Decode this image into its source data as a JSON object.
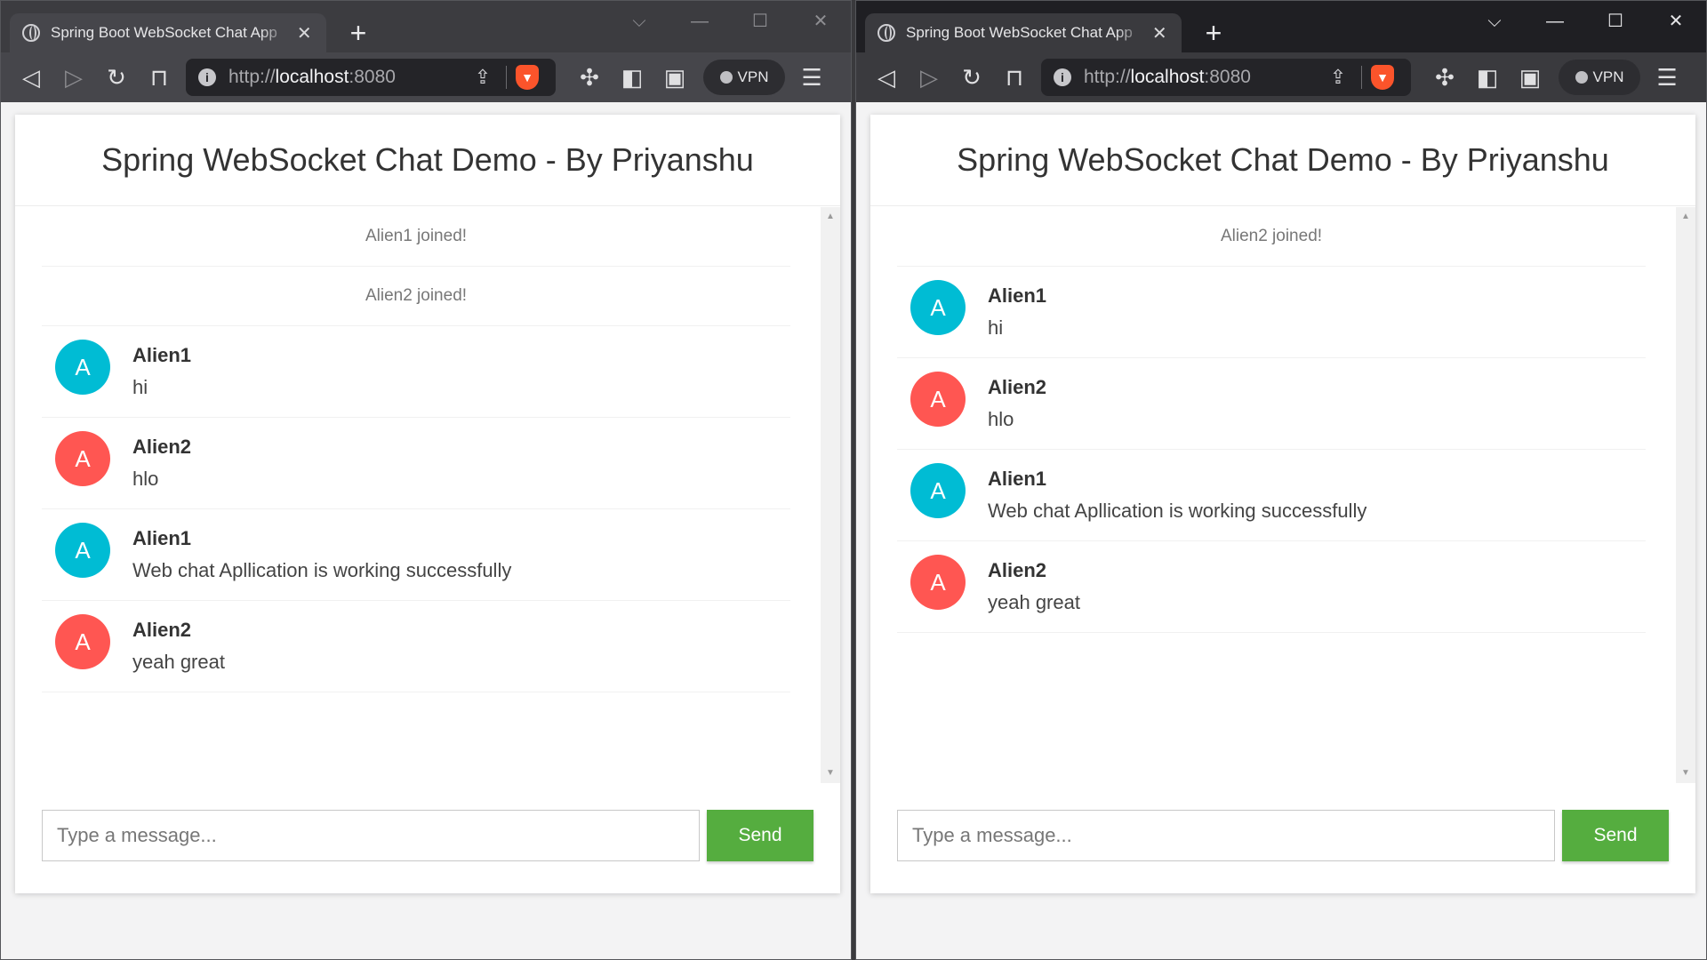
{
  "windows": [
    {
      "tab_title": "Spring Boot WebSocket Chat App",
      "url_scheme": "http://",
      "url_host": "localhost",
      "url_port": ":8080",
      "vpn_label": "VPN",
      "page_title": "Spring WebSocket Chat Demo - By Priyanshu",
      "events": [
        "Alien1 joined!",
        "Alien2 joined!"
      ],
      "messages": [
        {
          "avatar": "A",
          "sender": "Alien1",
          "text": "hi",
          "color": "#00bcd4"
        },
        {
          "avatar": "A",
          "sender": "Alien2",
          "text": "hlo",
          "color": "#ff5652"
        },
        {
          "avatar": "A",
          "sender": "Alien1",
          "text": "Web chat Apllication is working successfully",
          "color": "#00bcd4"
        },
        {
          "avatar": "A",
          "sender": "Alien2",
          "text": "yeah great",
          "color": "#ff5652"
        }
      ],
      "input_placeholder": "Type a message...",
      "send_label": "Send"
    },
    {
      "tab_title": "Spring Boot WebSocket Chat App",
      "url_scheme": "http://",
      "url_host": "localhost",
      "url_port": ":8080",
      "vpn_label": "VPN",
      "page_title": "Spring WebSocket Chat Demo - By Priyanshu",
      "events": [
        "Alien2 joined!"
      ],
      "messages": [
        {
          "avatar": "A",
          "sender": "Alien1",
          "text": "hi",
          "color": "#00bcd4"
        },
        {
          "avatar": "A",
          "sender": "Alien2",
          "text": "hlo",
          "color": "#ff5652"
        },
        {
          "avatar": "A",
          "sender": "Alien1",
          "text": "Web chat Apllication is working successfully",
          "color": "#00bcd4"
        },
        {
          "avatar": "A",
          "sender": "Alien2",
          "text": "yeah great",
          "color": "#ff5652"
        }
      ],
      "input_placeholder": "Type a message...",
      "send_label": "Send"
    }
  ],
  "icons": {
    "back": "back-icon",
    "forward": "forward-icon",
    "reload": "reload-icon",
    "bookmark": "bookmark-icon",
    "extensions": "puzzle-icon",
    "sidebar": "sidebar-icon",
    "wallet": "wallet-icon",
    "menu": "hamburger-icon"
  }
}
